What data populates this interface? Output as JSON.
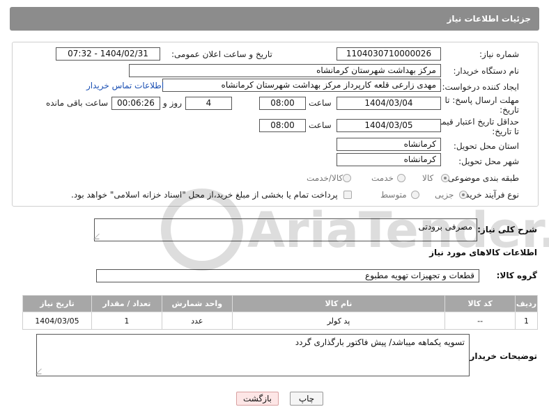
{
  "header": {
    "title": "جزئیات اطلاعات نیاز"
  },
  "form": {
    "need_number_label": "شماره نیاز:",
    "need_number": "1104030710000026",
    "announce_label": "تاریخ و ساعت اعلان عمومی:",
    "announce_value": "1404/02/31 - 07:32",
    "buyer_org_label": "نام دستگاه خریدار:",
    "buyer_org": "مرکز بهداشت شهرستان کرمانشاه",
    "creator_label": "ایجاد کننده درخواست:",
    "creator": "مهدی  زارعی قلعه کارپرداز مرکز بهداشت شهرستان کرمانشاه",
    "contact_link": "اطلاعات تماس خریدار",
    "reply_deadline_label_1": "مهلت ارسال پاسخ: تا",
    "reply_deadline_label_2": "تاریخ:",
    "reply_date": "1404/03/04",
    "time_label": "ساعت",
    "reply_time": "08:00",
    "days_value": "4",
    "days_label": "روز و",
    "remaining_time": "00:06:26",
    "remaining_label": "ساعت باقی مانده",
    "price_deadline_label_1": "حداقل تاریخ اعتبار قیمت:",
    "price_deadline_label_2": "تا تاریخ:",
    "price_date": "1404/03/05",
    "price_time": "08:00",
    "province_label": "استان محل تحویل:",
    "province": "کرمانشاه",
    "city_label": "شهر محل تحویل:",
    "city": "کرمانشاه",
    "category_label": "طبقه بندی موضوعی:",
    "category_options": [
      "کالا",
      "خدمت",
      "کالا/خدمت"
    ],
    "process_label": "نوع فرآیند خرید :",
    "process_options": [
      "جزیی",
      "متوسط"
    ],
    "payment_note": "پرداخت تمام یا بخشی از مبلغ خرید،از محل \"اسناد خزانه اسلامی\" خواهد بود."
  },
  "description": {
    "label": "شرح کلی نیاز:",
    "value": "مصرفی برودتی"
  },
  "goods": {
    "section_title": "اطلاعات کالاهای مورد نیاز",
    "group_label": "گروه کالا:",
    "group_value": "قطعات و تجهیزات تهویه مطبوع",
    "columns": [
      "ردیف",
      "کد کالا",
      "نام کالا",
      "واحد شمارش",
      "تعداد / مقدار",
      "تاریخ نیاز"
    ],
    "rows": [
      [
        "1",
        "--",
        "پد کولر",
        "عدد",
        "1",
        "1404/03/05"
      ]
    ]
  },
  "buyer_notes": {
    "label": "توضیحات خریدار:",
    "value": "تسویه یکماهه میباشد/ پیش فاکتور بارگذاری گردد"
  },
  "buttons": {
    "print": "چاپ",
    "back": "بازگشت"
  },
  "watermark": {
    "text": "AriaTender.net"
  }
}
